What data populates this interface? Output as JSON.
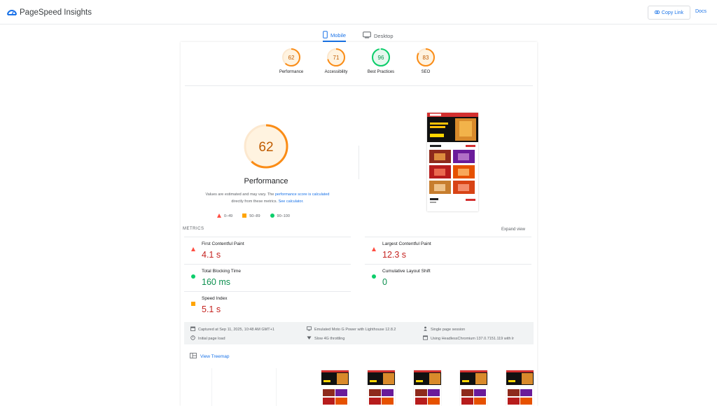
{
  "header": {
    "app_name": "PageSpeed Insights",
    "copy_link_label": "Copy Link",
    "docs_label": "Docs"
  },
  "tabs": [
    {
      "label": "Mobile",
      "icon": "smartphone-icon",
      "selected": true
    },
    {
      "label": "Desktop",
      "icon": "desktop-icon",
      "selected": false
    }
  ],
  "gauges": [
    {
      "score": "62",
      "label": "Performance",
      "value": 62,
      "color": "#fa8c16"
    },
    {
      "score": "71",
      "label": "Accessibility",
      "value": 71,
      "color": "#fa8c16"
    },
    {
      "score": "96",
      "label": "Best Practices",
      "value": 96,
      "color": "#0cce6b"
    },
    {
      "score": "83",
      "label": "SEO",
      "value": 83,
      "color": "#fa8c16"
    }
  ],
  "performance": {
    "score": "62",
    "value": 62,
    "title": "Performance",
    "note_prefix": "Values are estimated and may vary. The ",
    "note_link1": "performance score is calculated",
    "note_middle": " directly from these metrics. ",
    "note_link2": "See calculator."
  },
  "legend": [
    {
      "range": "0–49",
      "shape": "triangle",
      "color": "#ff4e42"
    },
    {
      "range": "50–89",
      "shape": "square",
      "color": "#ffa400"
    },
    {
      "range": "90–100",
      "shape": "circle",
      "color": "#0cce6b"
    }
  ],
  "metrics_section": {
    "heading": "METRICS",
    "expand_label": "Expand view"
  },
  "metrics": [
    {
      "name": "First Contentful Paint",
      "value": "4.1 s",
      "status": "poor"
    },
    {
      "name": "Largest Contentful Paint",
      "value": "12.3 s",
      "status": "poor"
    },
    {
      "name": "Total Blocking Time",
      "value": "160 ms",
      "status": "good"
    },
    {
      "name": "Cumulative Layout Shift",
      "value": "0",
      "status": "good"
    },
    {
      "name": "Speed Index",
      "value": "5.1 s",
      "status": "poor"
    }
  ],
  "run_info": {
    "captured": "Captured at Sep 11, 2025, 10:48 AM GMT+1",
    "load": "Initial page load",
    "device": "Emulated Moto G Power with Lighthouse 12.8.2",
    "throttling": "Slow 4G throttling",
    "session": "Single page session",
    "browser": "Using HeadlessChromium 137.0.7151.119 with lr"
  },
  "treemap_label": "View Treemap",
  "colors": {
    "accent": "#1a73e8",
    "poor": "#c5221f",
    "average": "#fa8c16",
    "good": "#0d904f"
  }
}
